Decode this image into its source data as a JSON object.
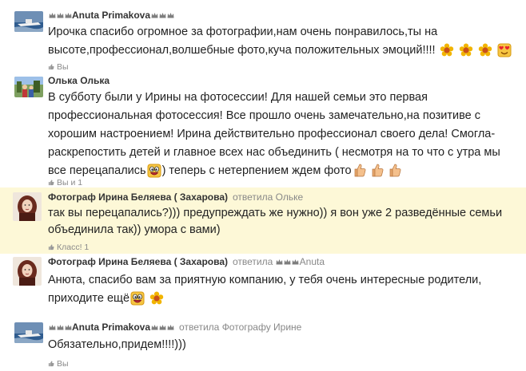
{
  "comments": [
    {
      "author": "Anuta Primakova",
      "text": "Ирочка спасибо огромное за фотографии,нам очень понравилось,ты на высоте,профессионал,волшебные фото,куча положительных эмоций!!!!",
      "meta": "Вы"
    },
    {
      "author": "Олька Олька",
      "text1": "В субботу были у Ирины на фотосессии! Для нашей семьи это первая профессиональная фотосессия! Все прошло очень замечательно,на позитиве с хорошим настроением! Ирина действительно профессионал своего дела! Смогла-раскрепостить детей и главное всех нас объединить ( несмотря на то что с утра мы все перецапались",
      "text2": ") теперь с нетерпением ждем фото",
      "meta": "Вы и 1"
    },
    {
      "author": "Фотограф Ирина Беляева ( Захарова)",
      "reply_label": "ответила",
      "reply_to": "Ольке",
      "text": "так вы перецапались?))) предупреждать же нужно)) я вон уже 2 разведённые семьи объединила так)) умора с вами)",
      "meta": "Класс! 1"
    },
    {
      "author": "Фотограф Ирина Беляева ( Захарова)",
      "reply_label": "ответила",
      "reply_to": "Anuta",
      "text": "Анюта, спасибо вам за приятную компанию, у тебя очень интересные родители, приходите ещё",
      "meta": ""
    },
    {
      "author": "Anuta Primakova",
      "reply_label": "ответила",
      "reply_to": "Фотографу Ирине",
      "text": "Обязательно,придем!!!!)))",
      "meta": "Вы"
    }
  ],
  "colors": {
    "highlight": "#fdf8d7",
    "meta_text": "#8a8a8a",
    "crown": "#888888"
  },
  "icons": [
    "crown-icon",
    "flower-emoji-icon",
    "heart-eyes-emoji-icon",
    "laughing-emoji-icon",
    "thumbs-up-emoji-icon",
    "like-icon"
  ]
}
